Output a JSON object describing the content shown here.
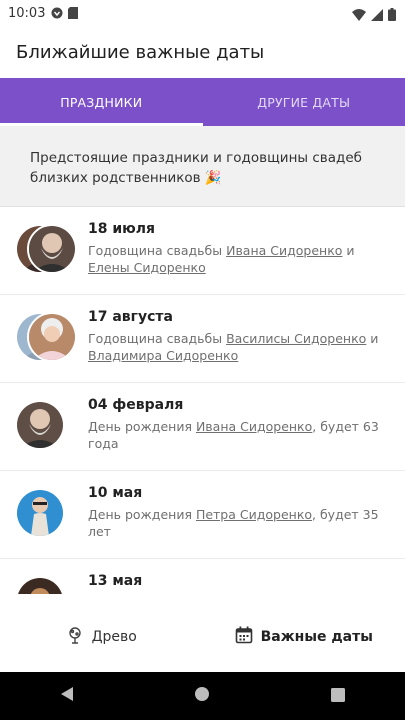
{
  "status_bar": {
    "time": "10:03",
    "left_icons": [
      "pocket-icon",
      "sd-card-icon"
    ],
    "right_icons": [
      "wifi-icon",
      "signal-icon",
      "battery-icon"
    ]
  },
  "app_bar": {
    "title": "Ближайшие важные даты"
  },
  "tabs": [
    {
      "label": "ПРАЗДНИКИ",
      "active": true
    },
    {
      "label": "ДРУГИЕ ДАТЫ",
      "active": false
    }
  ],
  "banner": {
    "text": "Предстоящие праздники и годовщины свадеб близких родственников",
    "emoji": "🎉"
  },
  "events": [
    {
      "date": "18 июля",
      "prefix": "Годовщина свадьбы ",
      "link1": "Ивана Сидоренко",
      "middle": " и ",
      "link2": "Елены Сидоренко",
      "suffix": ""
    },
    {
      "date": "17 августа",
      "prefix": "Годовщина свадьбы ",
      "link1": "Василисы Сидоренко",
      "middle": " и ",
      "link2": "Владимира Сидоренко",
      "suffix": ""
    },
    {
      "date": "04 февраля",
      "prefix": "День рождения ",
      "link1": "Ивана Сидоренко",
      "middle": ", будет 63 года",
      "link2": "",
      "suffix": ""
    },
    {
      "date": "10 мая",
      "prefix": "День рождения ",
      "link1": "Петра Сидоренко",
      "middle": ", будет 35 лет",
      "link2": "",
      "suffix": ""
    },
    {
      "date": "13 мая",
      "prefix": "",
      "link1": "",
      "middle": "",
      "link2": "",
      "suffix": ""
    }
  ],
  "bottom_nav": [
    {
      "label": "Древо",
      "icon": "tree-icon",
      "active": false
    },
    {
      "label": "Важные даты",
      "icon": "calendar-icon",
      "active": true
    }
  ],
  "colors": {
    "accent": "#7b50c8",
    "banner_bg": "#f1f1f1",
    "text_muted": "#6f6f6f"
  }
}
